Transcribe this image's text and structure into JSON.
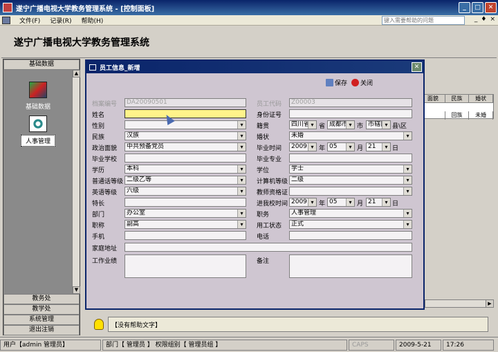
{
  "app": {
    "title": "遂宁广播电视大学教务管理系统 - [控制面板]",
    "min": "_",
    "max": "□",
    "close": "✕"
  },
  "menu": {
    "items": [
      "文件(F)",
      "记录(R)",
      "帮助(H)"
    ],
    "help_placeholder": "键入需要帮助的问题",
    "mdi_min": "_",
    "mdi_restore": "♦",
    "mdi_close": "×"
  },
  "banner": {
    "title": "遂宁广播电视大学教务管理系统"
  },
  "nav": {
    "header": "基础数据",
    "items": [
      {
        "label": "基础数据",
        "icon": "database-icon",
        "selected": false
      },
      {
        "label": "人事管理",
        "icon": "org-chart-icon",
        "selected": true
      }
    ],
    "groups": [
      "教务处",
      "教学处",
      "系统管理",
      "退出注销"
    ],
    "scroll_up": "▲",
    "scroll_down": "▼"
  },
  "bg_grid": {
    "headers": [
      "面貌",
      "民族",
      "婚状"
    ],
    "row": [
      "",
      "回族",
      "未婚"
    ]
  },
  "help": {
    "text": "【没有帮助文字】"
  },
  "status": {
    "user": "用户【admin 管理员】",
    "dept": "部门【 管理员 】 权限组别【 管理员组 】",
    "caps": "CAPS",
    "date": "2009-5-21",
    "time": "17:26"
  },
  "dialog": {
    "title": "员工信息_新增",
    "close": "✕",
    "save": "保存",
    "close_btn": "关闭",
    "fields": {
      "archive_no": {
        "label": "档案编号",
        "value": "DA20090501"
      },
      "emp_code": {
        "label": "员工代码",
        "value": "Z00003"
      },
      "name": {
        "label": "姓名",
        "value": ""
      },
      "id_no": {
        "label": "身份证号",
        "value": ""
      },
      "gender": {
        "label": "性别",
        "value": ""
      },
      "native": {
        "label": "籍贯",
        "province": "四川省",
        "p_unit": "省",
        "city": "成都市",
        "c_unit": "市",
        "county": "市辖区",
        "k_unit": "县\\区"
      },
      "ethnic": {
        "label": "民族",
        "value": "汉族"
      },
      "marital": {
        "label": "婚状",
        "value": "未婚"
      },
      "political": {
        "label": "政治面貌",
        "value": "中共预备党员"
      },
      "grad_date": {
        "label": "毕业时间",
        "year": "2009",
        "month": "05",
        "day": "21"
      },
      "school": {
        "label": "毕业学校",
        "value": ""
      },
      "major": {
        "label": "毕业专业",
        "value": ""
      },
      "education": {
        "label": "学历",
        "value": "本科"
      },
      "degree": {
        "label": "学位",
        "value": "学士"
      },
      "mandarin": {
        "label": "普通话等级",
        "value": "二级乙等"
      },
      "computer": {
        "label": "计算机等级",
        "value": "二级"
      },
      "english": {
        "label": "英语等级",
        "value": "六级"
      },
      "teacher_cert": {
        "label": "教师资格证",
        "value": ""
      },
      "specialty": {
        "label": "特长",
        "value": ""
      },
      "join_date": {
        "label": "进我校时间",
        "year": "2009",
        "month": "05",
        "day": "21"
      },
      "department": {
        "label": "部门",
        "value": "办公室"
      },
      "duty": {
        "label": "职务",
        "value": "人事管理"
      },
      "title_rank": {
        "label": "职称",
        "value": "副高"
      },
      "emp_status": {
        "label": "用工状态",
        "value": "正式"
      },
      "mobile": {
        "label": "手机",
        "value": ""
      },
      "phone": {
        "label": "电话",
        "value": ""
      },
      "address": {
        "label": "家庭地址",
        "value": ""
      },
      "performance": {
        "label": "工作业绩",
        "value": ""
      },
      "remark": {
        "label": "备注",
        "value": ""
      }
    },
    "units": {
      "year": "年",
      "month": "月",
      "day": "日"
    }
  }
}
